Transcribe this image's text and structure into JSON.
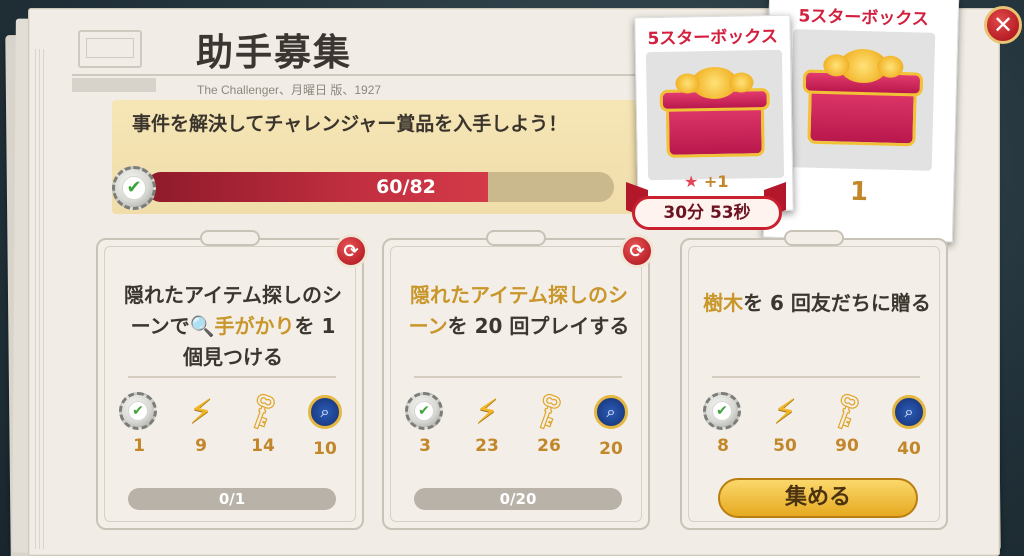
{
  "header": {
    "title": "助手募集",
    "subtitle": "The Challenger、月曜日 版、1927"
  },
  "goal": {
    "text": "事件を解決してチャレンジャー賞品を入手しよう！",
    "progress_text": "60/82",
    "progress_current": 60,
    "progress_total": 82
  },
  "rewards_cards": {
    "front": {
      "title": "5スターボックス",
      "bonus": "+1",
      "timer": "30分 53秒"
    },
    "back": {
      "title": "5スターボックス",
      "count": "1"
    }
  },
  "tasks": [
    {
      "text_a": "隠れたアイテム探しのシーンで",
      "text_b": "手がかり",
      "text_c": "を 1 個見つける",
      "rewards": [
        "1",
        "9",
        "14",
        "10"
      ],
      "progress": "0/1"
    },
    {
      "text_a": "隠れたアイテム探しのシーン",
      "text_b": "を 20 回プレイする",
      "rewards": [
        "3",
        "23",
        "26",
        "20"
      ],
      "progress": "0/20"
    },
    {
      "text_a": "樹木",
      "text_b": "を 6 回友だちに贈る",
      "rewards": [
        "8",
        "50",
        "90",
        "40"
      ],
      "button": "集める"
    }
  ],
  "icons": [
    "check-seal-icon",
    "energy-bolt-icon",
    "wind-key-icon",
    "magnifier-medal-icon",
    "refresh-icon",
    "close-icon",
    "star-icon"
  ],
  "colors": {
    "accent_red": "#c02e3f",
    "gold": "#c9962b",
    "banner": "#f0ddaa"
  }
}
